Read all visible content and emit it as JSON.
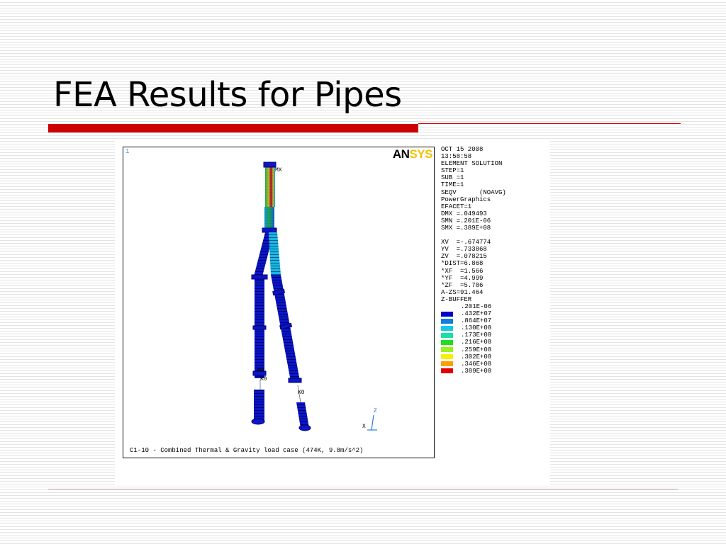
{
  "slide": {
    "title": "FEA Results for Pipes"
  },
  "figure": {
    "window_number": "1",
    "logo_an": "AN",
    "logo_sys": "SYS",
    "caption": "C1-10 - Combined Thermal & Gravity load case (474K, 9.8m/s^2)",
    "labels": {
      "mx": "MX",
      "mn": "MN",
      "k0_left": "K0",
      "k0_right": "K0",
      "axis_x": "X",
      "axis_z": "Z"
    },
    "info": [
      "OCT 15 2008",
      "13:58:58",
      "ELEMENT SOLUTION",
      "STEP=1",
      "SUB =1",
      "TIME=1",
      "SEQV      (NOAVG)",
      "PowerGraphics",
      "EFACET=1",
      "DMX =.049493",
      "SMN =.201E-06",
      "SMX =.389E+08"
    ],
    "view": [
      "XV  =-.674774",
      "YV  =.733868",
      "ZV  =.078215",
      "*DIST=6.868",
      "*XF  =1.566",
      "*YF  =4.999",
      "*ZF  =5.786",
      "A-ZS=91.464",
      "Z-BUFFER"
    ],
    "legend": {
      "first_value": ".201E-06",
      "entries": [
        {
          "value": ".432E+07",
          "color": "#0000cc"
        },
        {
          "value": ".864E+07",
          "color": "#0f7fe0"
        },
        {
          "value": ".130E+08",
          "color": "#16c8e8"
        },
        {
          "value": ".173E+08",
          "color": "#18e0a8"
        },
        {
          "value": ".216E+08",
          "color": "#22dd22"
        },
        {
          "value": ".259E+08",
          "color": "#9cf01c"
        },
        {
          "value": ".302E+08",
          "color": "#f2f200"
        },
        {
          "value": ".346E+08",
          "color": "#ff9d00"
        },
        {
          "value": ".389E+08",
          "color": "#e00000"
        }
      ]
    }
  }
}
